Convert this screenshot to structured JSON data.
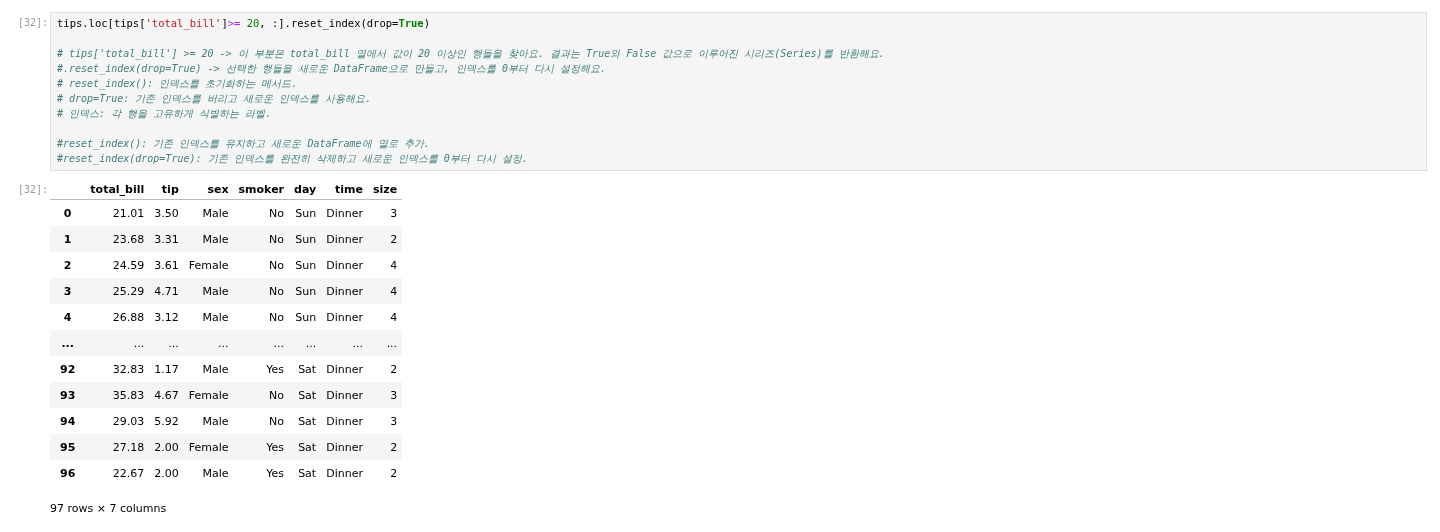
{
  "input_cell": {
    "prompt": "[32]:",
    "code_tokens": [
      {
        "text": "tips.loc[tips[",
        "kind": "plain"
      },
      {
        "text": "'total_bill'",
        "kind": "string"
      },
      {
        "text": "]",
        "kind": "plain"
      },
      {
        "text": ">=",
        "kind": "operator"
      },
      {
        "text": " 20",
        "kind": "number"
      },
      {
        "text": ", :].reset_index(drop=",
        "kind": "plain"
      },
      {
        "text": "True",
        "kind": "keyword"
      },
      {
        "text": ")",
        "kind": "plain"
      }
    ],
    "comment_blocks": [
      [
        "# tips['total_bill'] >= 20 -> 이 부분은 total_bill 열에서 값이 20 이상인 행들을 찾아요. 결과는 True와 False 값으로 이루어진 시리즈(Series)를 반환해요.",
        "#.reset_index(drop=True) -> 선택한 행들을 새로운 DataFrame으로 만들고, 인덱스를 0부터 다시 설정해요.",
        "# reset_index(): 인덱스를 초기화하는 메서드.",
        "# drop=True: 기존 인덱스를 버리고 새로운 인덱스를 사용해요.",
        "# 인덱스: 각 행을 고유하게 식별하는 라벨."
      ],
      [
        "#reset_index(): 기존 인덱스를 유지하고 새로운 DataFrame에 열로 추가.",
        "#reset_index(drop=True): 기존 인덱스를 완전히 삭제하고 새로운 인덱스를 0부터 다시 설정."
      ]
    ]
  },
  "output_cell": {
    "prompt": "[32]:",
    "table": {
      "columns": [
        "total_bill",
        "tip",
        "sex",
        "smoker",
        "day",
        "time",
        "size"
      ],
      "rows": [
        {
          "index": "0",
          "cells": [
            "21.01",
            "3.50",
            "Male",
            "No",
            "Sun",
            "Dinner",
            "3"
          ]
        },
        {
          "index": "1",
          "cells": [
            "23.68",
            "3.31",
            "Male",
            "No",
            "Sun",
            "Dinner",
            "2"
          ]
        },
        {
          "index": "2",
          "cells": [
            "24.59",
            "3.61",
            "Female",
            "No",
            "Sun",
            "Dinner",
            "4"
          ]
        },
        {
          "index": "3",
          "cells": [
            "25.29",
            "4.71",
            "Male",
            "No",
            "Sun",
            "Dinner",
            "4"
          ]
        },
        {
          "index": "4",
          "cells": [
            "26.88",
            "3.12",
            "Male",
            "No",
            "Sun",
            "Dinner",
            "4"
          ]
        },
        {
          "index": "...",
          "cells": [
            "...",
            "...",
            "...",
            "...",
            "...",
            "...",
            "..."
          ]
        },
        {
          "index": "92",
          "cells": [
            "32.83",
            "1.17",
            "Male",
            "Yes",
            "Sat",
            "Dinner",
            "2"
          ]
        },
        {
          "index": "93",
          "cells": [
            "35.83",
            "4.67",
            "Female",
            "No",
            "Sat",
            "Dinner",
            "3"
          ]
        },
        {
          "index": "94",
          "cells": [
            "29.03",
            "5.92",
            "Male",
            "No",
            "Sat",
            "Dinner",
            "3"
          ]
        },
        {
          "index": "95",
          "cells": [
            "27.18",
            "2.00",
            "Female",
            "Yes",
            "Sat",
            "Dinner",
            "2"
          ]
        },
        {
          "index": "96",
          "cells": [
            "22.67",
            "2.00",
            "Male",
            "Yes",
            "Sat",
            "Dinner",
            "2"
          ]
        }
      ]
    },
    "footer": "97 rows × 7 columns"
  }
}
